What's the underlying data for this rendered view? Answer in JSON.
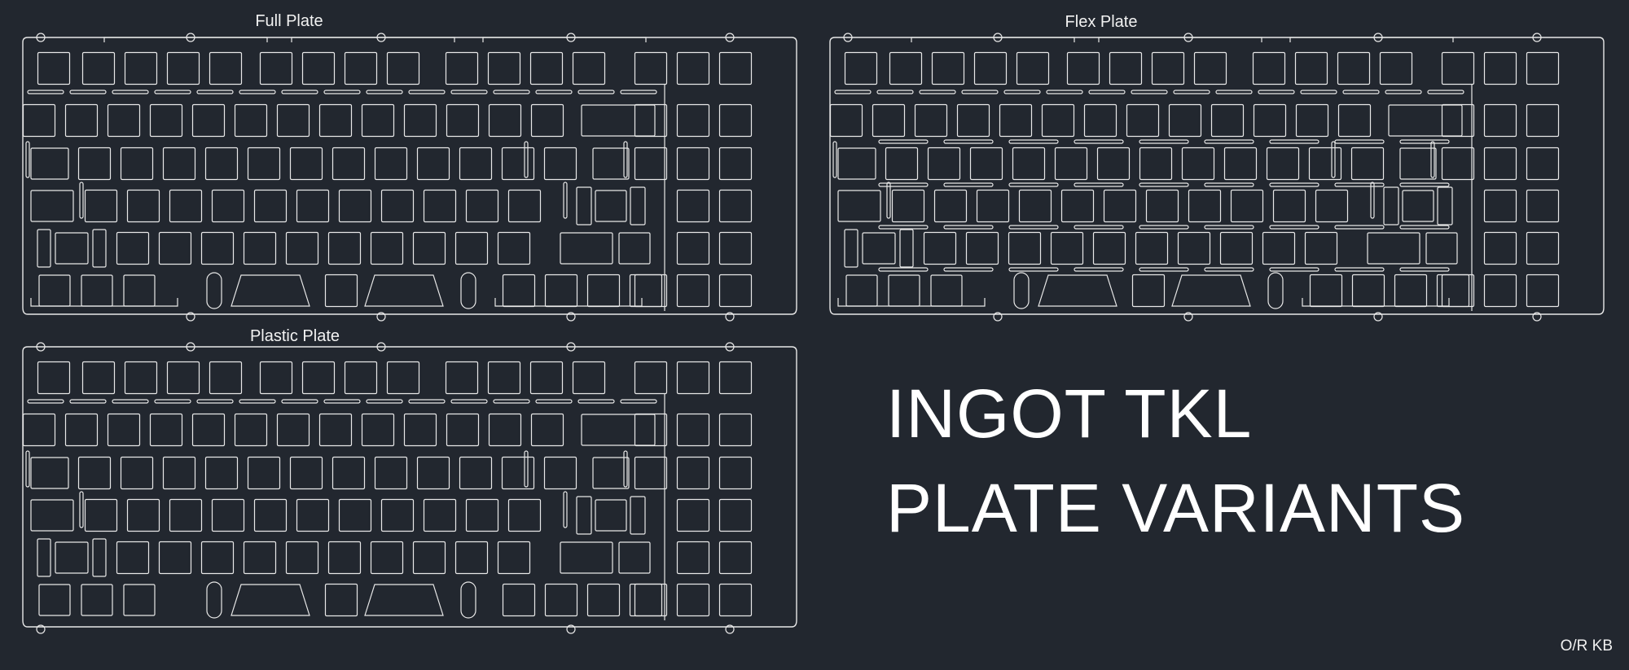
{
  "plates": [
    {
      "id": "full",
      "label": "Full Plate",
      "variant": "full"
    },
    {
      "id": "flex",
      "label": "Flex Plate",
      "variant": "flex"
    },
    {
      "id": "plastic",
      "label": "Plastic Plate",
      "variant": "plastic"
    }
  ],
  "title": {
    "line1": "INGOT TKL",
    "line2": "PLATE VARIANTS"
  },
  "credit": "O/R KB",
  "colors": {
    "background": "#22272f",
    "line": "#e8e8e8",
    "text": "#ffffff"
  }
}
